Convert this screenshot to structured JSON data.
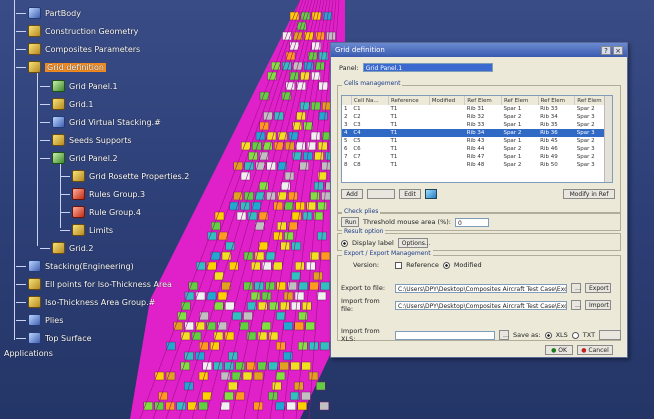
{
  "tree": {
    "items": [
      {
        "label": "PartBody",
        "icon": "body-icon"
      },
      {
        "label": "Construction Geometry",
        "icon": "geometry-icon"
      },
      {
        "label": "Composites Parameters",
        "icon": "parameters-icon"
      },
      {
        "label": "Grid definition",
        "icon": "grid-icon",
        "selected": true
      },
      {
        "label": "Grid Panel.1",
        "icon": "grid-panel-icon"
      },
      {
        "label": "Grid.1",
        "icon": "grid-icon"
      },
      {
        "label": "Grid Virtual Stacking.#",
        "icon": "stacking-icon"
      },
      {
        "label": "Seeds Supports",
        "icon": "seeds-icon"
      },
      {
        "label": "Grid Panel.2",
        "icon": "grid-panel-icon"
      },
      {
        "label": "Grid Rosette Properties.2",
        "icon": "rosette-icon"
      },
      {
        "label": "Rules Group.3",
        "icon": "rules-icon"
      },
      {
        "label": "Rule Group.4",
        "icon": "rules-icon"
      },
      {
        "label": "Limits",
        "icon": "limits-icon"
      },
      {
        "label": "Grid.2",
        "icon": "grid-icon"
      },
      {
        "label": "Stacking(Engineering)",
        "icon": "stacking-icon"
      },
      {
        "label": "Ell points for Iso-Thickness Area",
        "icon": "points-icon"
      },
      {
        "label": "Iso-Thickness Area Group.#",
        "icon": "area-icon"
      },
      {
        "label": "Plies",
        "icon": "plies-icon"
      },
      {
        "label": "Top Surface",
        "icon": "surface-icon"
      }
    ],
    "applications_label": "Applications"
  },
  "dialog": {
    "title": "Grid definition",
    "panel_label": "Panel:",
    "panel_value": "Grid Panel.1",
    "cells_group": "Cells management",
    "columns": [
      "",
      "Cell Na...",
      "Reference",
      "Modified",
      "Ref Elem",
      "Ref Elem",
      "Ref Elem",
      "Ref Elem"
    ],
    "rows": [
      [
        "1",
        "C1",
        "T1",
        "",
        "Rib 31",
        "Spar 1",
        "Rib 33",
        "Spar 2"
      ],
      [
        "2",
        "C2",
        "T1",
        "",
        "Rib 32",
        "Spar 2",
        "Rib 34",
        "Spar 3"
      ],
      [
        "3",
        "C3",
        "T1",
        "",
        "Rib 33",
        "Spar 1",
        "Rib 35",
        "Spar 2"
      ],
      [
        "4",
        "C4",
        "T1",
        "",
        "Rib 34",
        "Spar 2",
        "Rib 36",
        "Spar 3"
      ],
      [
        "5",
        "C5",
        "T1",
        "",
        "Rib 43",
        "Spar 1",
        "Rib 45",
        "Spar 2"
      ],
      [
        "6",
        "C6",
        "T1",
        "",
        "Rib 44",
        "Spar 2",
        "Rib 46",
        "Spar 3"
      ],
      [
        "7",
        "C7",
        "T1",
        "",
        "Rib 47",
        "Spar 1",
        "Rib 49",
        "Spar 2"
      ],
      [
        "8",
        "C8",
        "T1",
        "",
        "Rib 48",
        "Spar 2",
        "Rib 50",
        "Spar 3"
      ]
    ],
    "selected_row": 3,
    "btn_add": "Add",
    "btn_remove": "",
    "btn_edit": "Edit",
    "btn_modify": "Modify in Ref",
    "check_ply_group": "Check plies",
    "btn_run": "Run",
    "threshold_label": "Threshold mouse area (%):",
    "threshold_value": "0",
    "about_group": "Result option",
    "display_label": "Display label",
    "btn_options": "Options...",
    "export_group": "Export / Export Management",
    "version_label": "Version:",
    "reference_label": "Reference",
    "modified_label": "Modified",
    "export_file_label": "Export to file:",
    "export_file_value": "C:\\Users\\DPY\\Desktop\\Composites Aircraft Test Case\\Excel",
    "btn_export": "Export",
    "import_file_label": "Import from file:",
    "import_file_value": "C:\\Users\\DPY\\Desktop\\Composites Aircraft Test Case\\Excel",
    "btn_import": "Import",
    "import_xls_label": "Import from XLS:",
    "save_as_label": "Save as:",
    "xls_label": "XLS",
    "txt_label": "TXT",
    "btn_ok": "OK",
    "btn_cancel": "Cancel"
  },
  "colors": {
    "background": "#2d3f77",
    "grid_magenta": "#e020c8",
    "highlight": "#f08a20"
  }
}
